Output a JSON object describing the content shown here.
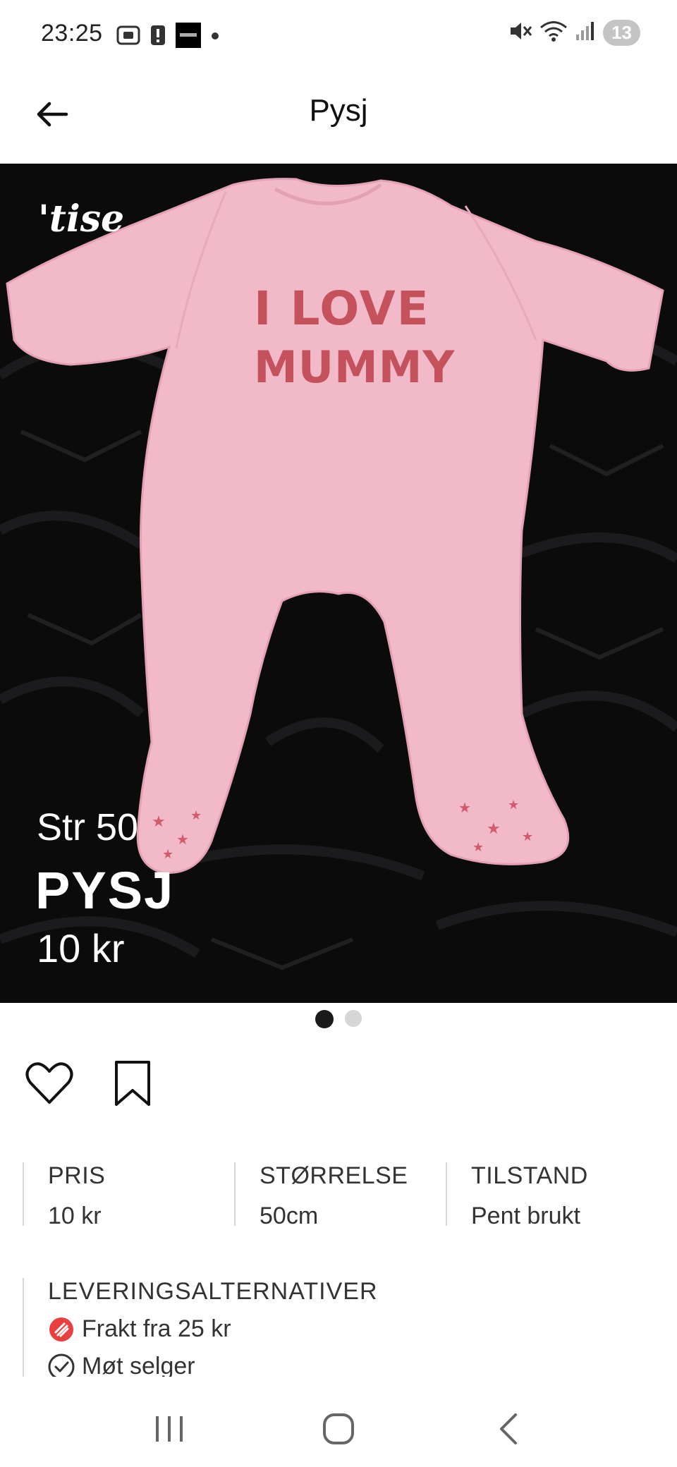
{
  "status_bar": {
    "time": "23:25",
    "battery": "13",
    "icons": [
      "screenshot-icon",
      "alert-icon",
      "app-thumbnail-icon",
      "dot-icon",
      "mute-icon",
      "wifi-icon",
      "signal-icon"
    ]
  },
  "header": {
    "title": "Pysj",
    "back_icon": "arrow-left-icon"
  },
  "hero": {
    "watermark": "'tise",
    "size_text": "Str 50",
    "title_text": "PYSJ",
    "price_text": "10 kr",
    "shirt_text_line1": "I LOVE",
    "shirt_text_line2": "MUMMY",
    "image_count": 2,
    "current_image": 1
  },
  "actions": {
    "like_icon": "heart-icon",
    "save_icon": "bookmark-icon"
  },
  "details": [
    {
      "label": "PRIS",
      "value": "10 kr"
    },
    {
      "label": "STØRRELSE",
      "value": "50cm"
    },
    {
      "label": "TILSTAND",
      "value": "Pent brukt"
    }
  ],
  "delivery": {
    "title": "LEVERINGSALTERNATIVER",
    "options": [
      {
        "label": "Frakt fra 25 kr",
        "icon": "shipping-icon"
      },
      {
        "label": "Møt selger",
        "icon": "check-circle-icon"
      }
    ]
  },
  "colors": {
    "accent_red": "#e8403f",
    "onesie_pink": "#f0b7c7",
    "print_red": "#c4525c",
    "background_dark": "#0a0a0a"
  },
  "nav": {
    "recents_icon": "recents-icon",
    "home_icon": "home-icon",
    "back_icon": "back-chevron-icon"
  }
}
